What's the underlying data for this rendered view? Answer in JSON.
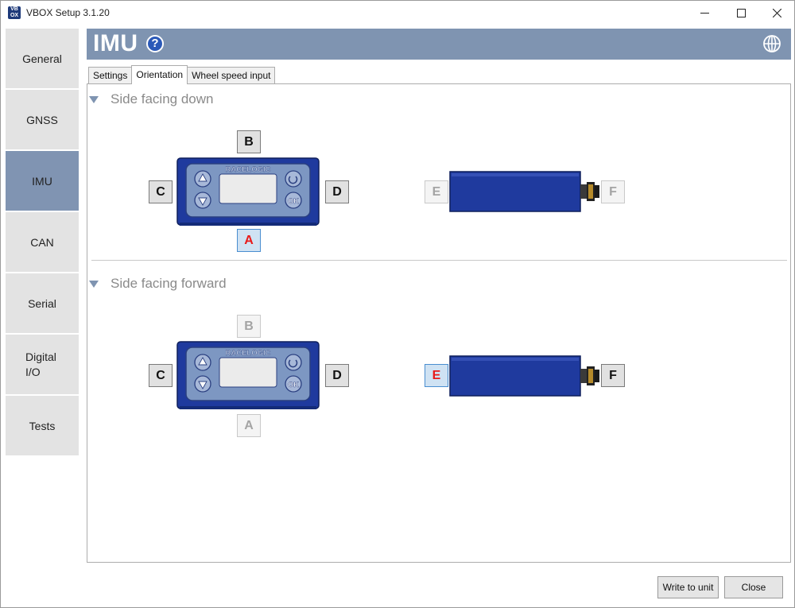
{
  "window": {
    "title": "VBOX Setup 3.1.20"
  },
  "sidebar": {
    "items": [
      {
        "label": "General"
      },
      {
        "label": "GNSS"
      },
      {
        "label": "IMU"
      },
      {
        "label": "CAN"
      },
      {
        "label": "Serial"
      },
      {
        "label": "Digital I/O"
      },
      {
        "label": "Tests"
      }
    ],
    "active_index": 2
  },
  "header": {
    "title": "IMU",
    "help_icon": "help-icon",
    "globe_icon": "globe-icon",
    "color": "#7f94b1"
  },
  "tabs": [
    {
      "label": "Settings"
    },
    {
      "label": "Orientation"
    },
    {
      "label": "Wheel speed input"
    }
  ],
  "active_tab": 1,
  "sections": {
    "down": {
      "title": "Side facing down",
      "labels": {
        "B": "B",
        "C": "C",
        "D": "D",
        "A": "A",
        "E": "E",
        "F": "F"
      },
      "selected": "A"
    },
    "forward": {
      "title": "Side facing forward",
      "labels": {
        "B": "B",
        "C": "C",
        "D": "D",
        "A": "A",
        "E": "E",
        "F": "F"
      },
      "selected": "E"
    }
  },
  "device": {
    "brand": "RACELOGIC",
    "ok_label": "OK",
    "body_color": "#1f3a9e",
    "panel_color": "#7d97c2",
    "selected_text_color": "#e81a1a"
  },
  "buttons": {
    "write": "Write to unit",
    "close": "Close"
  }
}
